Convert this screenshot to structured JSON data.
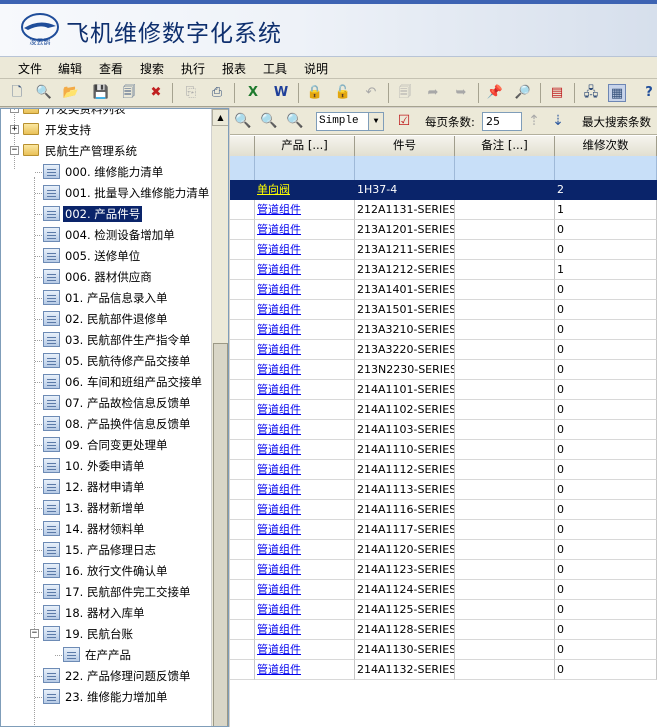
{
  "app": {
    "title": "飞机维修数字化系统",
    "logo_text": "凌云鹊"
  },
  "menu": [
    "文件",
    "编辑",
    "查看",
    "搜索",
    "执行",
    "报表",
    "工具",
    "说明"
  ],
  "toolbar_icons": [
    "new-icon",
    "preview-icon",
    "open-folder-icon",
    "save-icon",
    "save-as-icon",
    "delete-icon",
    "copy-icon",
    "print-icon",
    "excel-icon",
    "word-icon",
    "lock-icon",
    "unlock-icon",
    "undo-icon",
    "copy-doc-icon",
    "forward-icon",
    "back-icon",
    "pin-icon",
    "find-icon",
    "print-setup-icon",
    "network-icon",
    "grid-view-icon",
    "help-icon"
  ],
  "tree": [
    {
      "label": "开发类资料列表",
      "type": "folder",
      "level": 0,
      "expander": "+"
    },
    {
      "label": "开发支持",
      "type": "folder",
      "level": 0,
      "expander": "+"
    },
    {
      "label": "民航生产管理系统",
      "type": "folder",
      "level": 0,
      "expander": "−"
    },
    {
      "label": "000. 维修能力清单",
      "type": "doc",
      "level": 1
    },
    {
      "label": "001. 批量导入维修能力清单",
      "type": "doc",
      "level": 1
    },
    {
      "label": "002. 产品件号",
      "type": "doc",
      "level": 1,
      "selected": true
    },
    {
      "label": "004. 检测设备增加单",
      "type": "doc",
      "level": 1
    },
    {
      "label": "005. 送修单位",
      "type": "doc",
      "level": 1
    },
    {
      "label": "006. 器材供应商",
      "type": "doc",
      "level": 1
    },
    {
      "label": "01. 产品信息录入单",
      "type": "doc",
      "level": 1
    },
    {
      "label": "02. 民航部件退修单",
      "type": "doc",
      "level": 1
    },
    {
      "label": "03. 民航部件生产指令单",
      "type": "doc",
      "level": 1
    },
    {
      "label": "05. 民航待修产品交接单",
      "type": "doc",
      "level": 1
    },
    {
      "label": "06. 车间和班组产品交接单",
      "type": "doc",
      "level": 1
    },
    {
      "label": "07. 产品故检信息反馈单",
      "type": "doc",
      "level": 1
    },
    {
      "label": "08. 产品换件信息反馈单",
      "type": "doc",
      "level": 1
    },
    {
      "label": "09. 合同变更处理单",
      "type": "doc",
      "level": 1
    },
    {
      "label": "10. 外委申请单",
      "type": "doc",
      "level": 1
    },
    {
      "label": "12. 器材申请单",
      "type": "doc",
      "level": 1
    },
    {
      "label": "13. 器材新增单",
      "type": "doc",
      "level": 1
    },
    {
      "label": "14. 器材领料单",
      "type": "doc",
      "level": 1
    },
    {
      "label": "15. 产品修理日志",
      "type": "doc",
      "level": 1
    },
    {
      "label": "16. 放行文件确认单",
      "type": "doc",
      "level": 1
    },
    {
      "label": "17. 民航部件完工交接单",
      "type": "doc",
      "level": 1
    },
    {
      "label": "18. 器材入库单",
      "type": "doc",
      "level": 1
    },
    {
      "label": "19. 民航台账",
      "type": "doc",
      "level": 1,
      "expander": "−"
    },
    {
      "label": "在产产品",
      "type": "doc",
      "level": 2
    },
    {
      "label": "22. 产品修理问题反馈单",
      "type": "doc",
      "level": 1
    },
    {
      "label": "23. 维修能力增加单",
      "type": "doc",
      "level": 1
    }
  ],
  "query_bar": {
    "mode": "Simple",
    "page_size_label": "每页条数:",
    "page_size": "25",
    "max_search_label": "最大搜索条数"
  },
  "grid": {
    "columns": [
      "产品 [...]",
      "件号",
      "备注 [...]",
      "维修次数"
    ],
    "rows": [
      {
        "product": "单向阀",
        "part": "1H37-4",
        "note": "",
        "count": "2",
        "selected": true
      },
      {
        "product": "管道组件",
        "part": "212A1131-SERIES",
        "note": "",
        "count": "1"
      },
      {
        "product": "管道组件",
        "part": "213A1201-SERIES",
        "note": "",
        "count": "0"
      },
      {
        "product": "管道组件",
        "part": "213A1211-SERIES",
        "note": "",
        "count": "0"
      },
      {
        "product": "管道组件",
        "part": "213A1212-SERIES",
        "note": "",
        "count": "1"
      },
      {
        "product": "管道组件",
        "part": "213A1401-SERIES",
        "note": "",
        "count": "0"
      },
      {
        "product": "管道组件",
        "part": "213A1501-SERIES",
        "note": "",
        "count": "0"
      },
      {
        "product": "管道组件",
        "part": "213A3210-SERIES",
        "note": "",
        "count": "0"
      },
      {
        "product": "管道组件",
        "part": "213A3220-SERIES",
        "note": "",
        "count": "0"
      },
      {
        "product": "管道组件",
        "part": "213N2230-SERIES",
        "note": "",
        "count": "0"
      },
      {
        "product": "管道组件",
        "part": "214A1101-SERIES",
        "note": "",
        "count": "0"
      },
      {
        "product": "管道组件",
        "part": "214A1102-SERIES",
        "note": "",
        "count": "0"
      },
      {
        "product": "管道组件",
        "part": "214A1103-SERIES",
        "note": "",
        "count": "0"
      },
      {
        "product": "管道组件",
        "part": "214A1110-SERIES",
        "note": "",
        "count": "0"
      },
      {
        "product": "管道组件",
        "part": "214A1112-SERIES",
        "note": "",
        "count": "0"
      },
      {
        "product": "管道组件",
        "part": "214A1113-SERIES",
        "note": "",
        "count": "0"
      },
      {
        "product": "管道组件",
        "part": "214A1116-SERIES",
        "note": "",
        "count": "0"
      },
      {
        "product": "管道组件",
        "part": "214A1117-SERIES",
        "note": "",
        "count": "0"
      },
      {
        "product": "管道组件",
        "part": "214A1120-SERIES",
        "note": "",
        "count": "0"
      },
      {
        "product": "管道组件",
        "part": "214A1123-SERIES",
        "note": "",
        "count": "0"
      },
      {
        "product": "管道组件",
        "part": "214A1124-SERIES",
        "note": "",
        "count": "0"
      },
      {
        "product": "管道组件",
        "part": "214A1125-SERIES",
        "note": "",
        "count": "0"
      },
      {
        "product": "管道组件",
        "part": "214A1128-SERIES",
        "note": "",
        "count": "0"
      },
      {
        "product": "管道组件",
        "part": "214A1130-SERIES",
        "note": "",
        "count": "0"
      },
      {
        "product": "管道组件",
        "part": "214A1132-SERIES",
        "note": "",
        "count": "0"
      }
    ]
  }
}
